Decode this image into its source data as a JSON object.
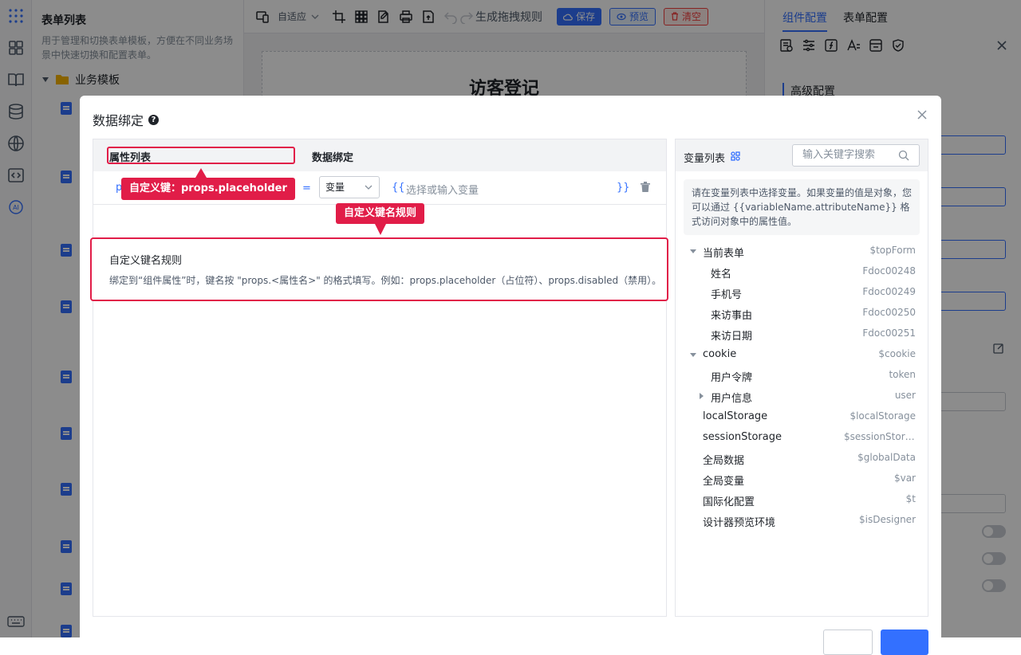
{
  "template_panel": {
    "title": "表单列表",
    "description": "用于管理和切换表单模板，方便在不同业务场景中快速切换和配置表单。",
    "folder": "业务模板"
  },
  "toolbar": {
    "layout_mode": "自适应",
    "generate_rule_label": "生成拖拽规则",
    "save_label": "保存",
    "preview_label": "预览",
    "clear_label": "清空"
  },
  "canvas": {
    "form_title": "访客登记"
  },
  "config_panel": {
    "tab_component": "组件配置",
    "tab_form": "表单配置",
    "section_title": "高级配置"
  },
  "dialog": {
    "title": "数据绑定",
    "columns": {
      "attribute_list": "属性列表",
      "data_binding": "数据绑定"
    },
    "row": {
      "key_visible": "p",
      "equals": "=",
      "type_value": "变量",
      "brace_open": "{{",
      "brace_close": "}}",
      "placeholder": "选择或输入变量"
    },
    "tooltip_custom_key": "自定义键：props.placeholder",
    "tooltip_naming_rule": "自定义键名规则",
    "rule_box": {
      "title": "自定义键名规则",
      "description": "绑定到“组件属性”时，键名按 \"props.<属性名>\" 的格式填写。例如：props.placeholder（占位符）、props.disabled（禁用）。"
    },
    "variables": {
      "title": "变量列表",
      "search_placeholder": "输入关键字搜索",
      "note": "请在变量列表中选择变量。如果变量的值是对象，您可以通过 {{variableName.attributeName}} 格式访问对象中的属性值。",
      "tree": [
        {
          "label": "当前表单",
          "value": "$topForm"
        },
        {
          "label": "姓名",
          "value": "Fdoc00248"
        },
        {
          "label": "手机号",
          "value": "Fdoc00249"
        },
        {
          "label": "来访事由",
          "value": "Fdoc00250"
        },
        {
          "label": "来访日期",
          "value": "Fdoc00251"
        },
        {
          "label": "cookie",
          "value": "$cookie"
        },
        {
          "label": "用户令牌",
          "value": "token"
        },
        {
          "label": "用户信息",
          "value": "user"
        },
        {
          "label": "localStorage",
          "value": "$localStorage"
        },
        {
          "label": "sessionStorage",
          "value": "$sessionStorage"
        },
        {
          "label": "全局数据",
          "value": "$globalData"
        },
        {
          "label": "全局变量",
          "value": "$var"
        },
        {
          "label": "国际化配置",
          "value": "$t"
        },
        {
          "label": "设计器预览环境",
          "value": "$isDesigner"
        }
      ]
    }
  },
  "colors": {
    "accent": "#3370ff",
    "highlight": "#e11d48",
    "danger": "#f53f3f"
  }
}
